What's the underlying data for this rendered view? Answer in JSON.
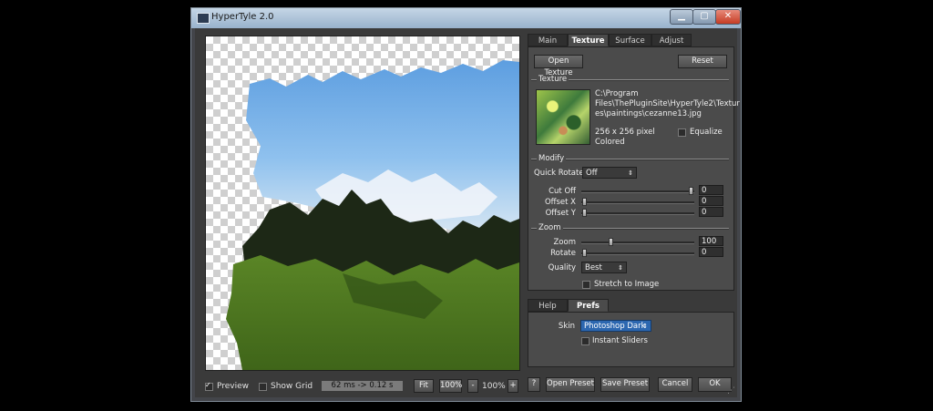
{
  "window": {
    "title": "HyperTyle 2.0",
    "minimize_glyph": "▁",
    "maximize_glyph": "▢",
    "close_glyph": "✕"
  },
  "tabs_top": [
    {
      "label": "Main",
      "active": false
    },
    {
      "label": "Texture",
      "active": true
    },
    {
      "label": "Surface",
      "active": false
    },
    {
      "label": "Adjust",
      "active": false
    }
  ],
  "texture_panel": {
    "open_texture_label": "Open Texture",
    "reset_label": "Reset",
    "texture_section": "Texture",
    "path_lines": [
      "C:\\Program",
      "Files\\ThePluginSite\\HyperTyle2\\Textur",
      "es\\paintings\\cezanne13.jpg"
    ],
    "size_text": "256 x 256 pixel",
    "color_text": "Colored",
    "equalize_label": "Equalize",
    "equalize_checked": false,
    "modify_section": "Modify",
    "quick_rotate_label": "Quick Rotate",
    "quick_rotate_value": "Off",
    "cut_off_label": "Cut Off",
    "cut_off_value": "0",
    "offset_x_label": "Offset X",
    "offset_x_value": "0",
    "offset_y_label": "Offset Y",
    "offset_y_value": "0",
    "zoom_section": "Zoom",
    "zoom_label": "Zoom",
    "zoom_value": "100",
    "rotate_label": "Rotate",
    "rotate_value": "0",
    "quality_label": "Quality",
    "quality_value": "Best",
    "stretch_label": "Stretch to Image",
    "stretch_checked": false
  },
  "tabs_bottom": [
    {
      "label": "Help",
      "active": false
    },
    {
      "label": "Prefs",
      "active": true
    }
  ],
  "prefs_panel": {
    "skin_label": "Skin",
    "skin_value": "Photoshop Dark",
    "instant_sliders_label": "Instant Sliders",
    "instant_sliders_checked": false
  },
  "footer": {
    "preview_label": "Preview",
    "preview_checked": true,
    "show_grid_label": "Show Grid",
    "show_grid_checked": false,
    "timing_text": "62 ms -> 0.12 s",
    "fit_label": "Fit",
    "zoom_100_label": "100%",
    "minus_label": "-",
    "zoom_display": "100%",
    "plus_label": "+",
    "help_label": "?",
    "open_preset_label": "Open Preset",
    "save_preset_label": "Save Preset",
    "cancel_label": "Cancel",
    "ok_label": "OK"
  },
  "colors": {
    "skin_accent": "#2c67b0",
    "panel_bg": "#4b4b4b",
    "preview_sky": "#7fb7ea",
    "preview_trees": "#1e2a18",
    "preview_grass": "#4f7a22"
  },
  "icons": {
    "caret": "⇕",
    "resize_grip": "⋰"
  }
}
